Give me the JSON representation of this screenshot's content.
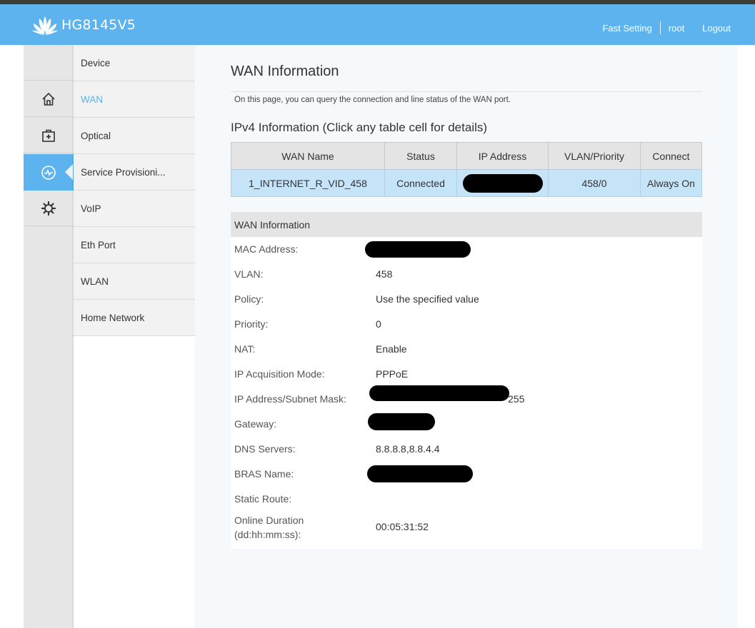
{
  "header": {
    "brand": "HG8145V5",
    "links": {
      "fast_setting": "Fast Setting",
      "user": "root",
      "logout": "Logout"
    },
    "color": "#5cb3ee"
  },
  "nav_icons": [
    "home-icon",
    "medical-kit-icon",
    "pulse-icon",
    "gear-icon"
  ],
  "menu": {
    "items": [
      "Device",
      "WAN",
      "Optical",
      "Service Provisioni...",
      "VoIP",
      "Eth Port",
      "WLAN",
      "Home Network"
    ],
    "selected": "WAN"
  },
  "page": {
    "title": "WAN Information",
    "description": "On this page, you can query the connection and line status of the WAN port.",
    "ipv4_heading": "IPv4 Information (Click any table cell for details)"
  },
  "ipv4_table": {
    "headers": [
      "WAN Name",
      "Status",
      "IP Address",
      "VLAN/Priority",
      "Connect"
    ],
    "row": {
      "wan_name": "1_INTERNET_R_VID_458",
      "status": "Connected",
      "ip_address": "",
      "vlan_priority": "458/0",
      "connect": "Always On"
    }
  },
  "wan_info": {
    "title": "WAN Information",
    "mac_label": "MAC Address:",
    "vlan_label": "VLAN:",
    "vlan": "458",
    "policy_label": "Policy:",
    "policy": "Use the specified value",
    "priority_label": "Priority:",
    "priority": "0",
    "nat_label": "NAT:",
    "nat": "Enable",
    "mode_label": "IP Acquisition Mode:",
    "mode": "PPPoE",
    "ip_mask_label": "IP Address/Subnet Mask:",
    "ip_mask_tail": "255",
    "gateway_label": "Gateway:",
    "dns_label": "DNS Servers:",
    "dns": "8.8.8.8,8.8.4.4",
    "bras_label": "BRAS Name:",
    "static_route_label": "Static Route:",
    "duration_label": "Online Duration (dd:hh:mm:ss):",
    "duration": "00:05:31:52"
  }
}
